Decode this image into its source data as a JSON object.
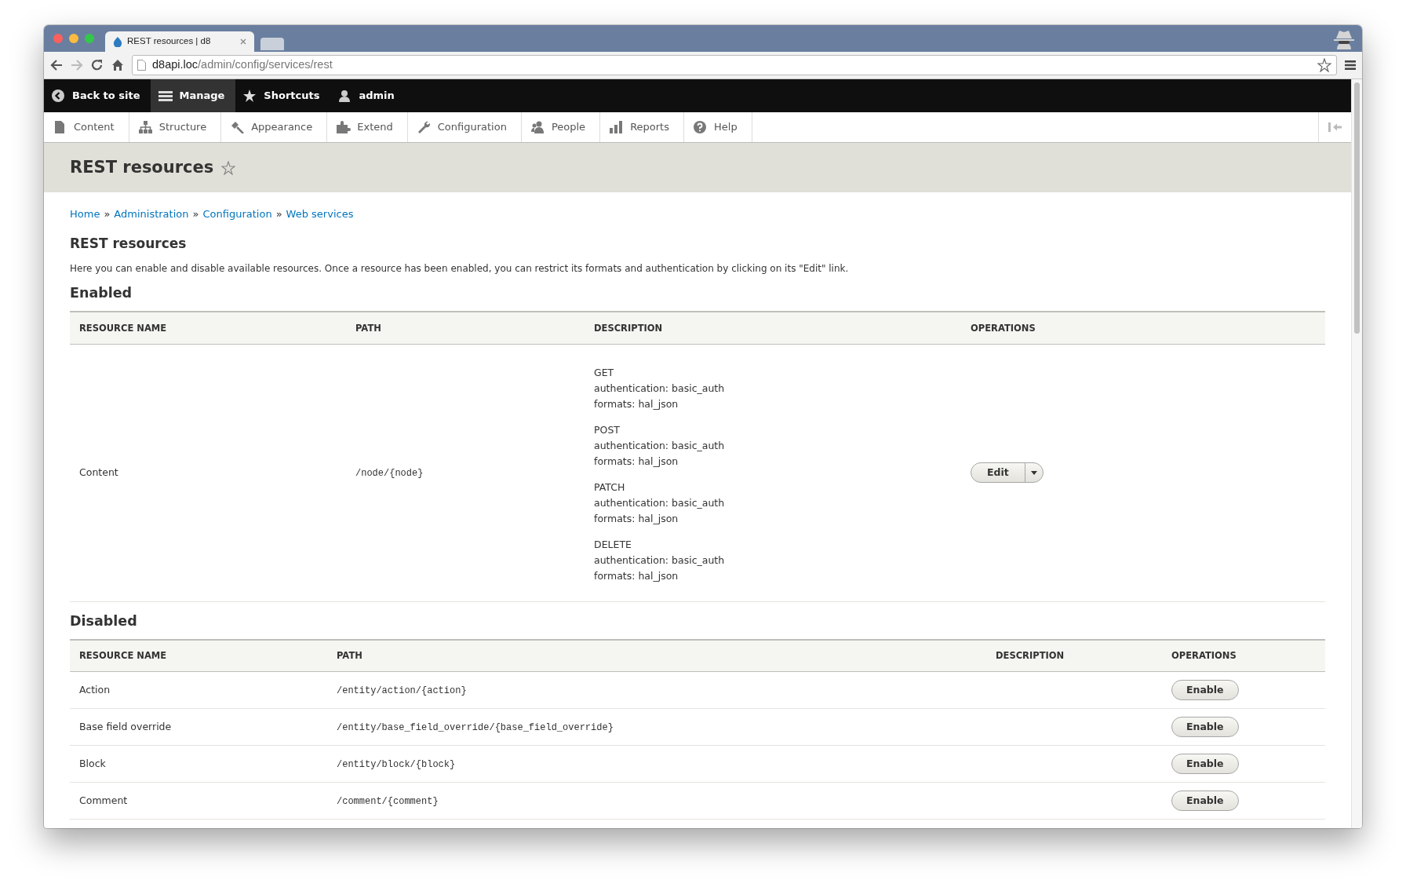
{
  "browser": {
    "tab_title": "REST resources | d8",
    "url_host": "d8api.loc",
    "url_path": "/admin/config/services/rest"
  },
  "toolbar": {
    "items": [
      {
        "label": "Back to site",
        "selected": false
      },
      {
        "label": "Manage",
        "selected": true
      },
      {
        "label": "Shortcuts",
        "selected": false
      },
      {
        "label": "admin",
        "selected": false
      }
    ]
  },
  "tray": {
    "items": [
      {
        "label": "Content"
      },
      {
        "label": "Structure"
      },
      {
        "label": "Appearance"
      },
      {
        "label": "Extend"
      },
      {
        "label": "Configuration"
      },
      {
        "label": "People"
      },
      {
        "label": "Reports"
      },
      {
        "label": "Help"
      }
    ]
  },
  "page_title": "REST resources",
  "breadcrumb": [
    {
      "kind": "link",
      "text": "Home"
    },
    {
      "kind": "separator",
      "text": "»"
    },
    {
      "kind": "link",
      "text": "Administration"
    },
    {
      "kind": "separator",
      "text": "»"
    },
    {
      "kind": "link",
      "text": "Configuration"
    },
    {
      "kind": "separator",
      "text": "»"
    },
    {
      "kind": "link",
      "text": "Web services"
    }
  ],
  "heading": "REST resources",
  "description": "Here you can enable and disable available resources. Once a resource has been enabled, you can restrict its formats and authentication by clicking on its \"Edit\" link.",
  "sections": [
    {
      "title": "Enabled",
      "kind": "enabled",
      "columns": [
        "RESOURCE NAME",
        "PATH",
        "DESCRIPTION",
        "OPERATIONS"
      ],
      "rows": [
        {
          "name": "Content",
          "path": "/node/{node}",
          "description": [
            {
              "method": "GET",
              "lines": [
                "authentication: basic_auth",
                "formats: hal_json"
              ]
            },
            {
              "method": "POST",
              "lines": [
                "authentication: basic_auth",
                "formats: hal_json"
              ]
            },
            {
              "method": "PATCH",
              "lines": [
                "authentication: basic_auth",
                "formats: hal_json"
              ]
            },
            {
              "method": "DELETE",
              "lines": [
                "authentication: basic_auth",
                "formats: hal_json"
              ]
            }
          ],
          "operation": "Edit"
        }
      ]
    },
    {
      "title": "Disabled",
      "kind": "disabled",
      "columns": [
        "RESOURCE NAME",
        "PATH",
        "DESCRIPTION",
        "OPERATIONS"
      ],
      "rows": [
        {
          "name": "Action",
          "path": "/entity/action/{action}",
          "operation": "Enable"
        },
        {
          "name": "Base field override",
          "path": "/entity/base_field_override/{base_field_override}",
          "operation": "Enable"
        },
        {
          "name": "Block",
          "path": "/entity/block/{block}",
          "operation": "Enable"
        },
        {
          "name": "Comment",
          "path": "/comment/{comment}",
          "operation": "Enable"
        }
      ]
    }
  ]
}
